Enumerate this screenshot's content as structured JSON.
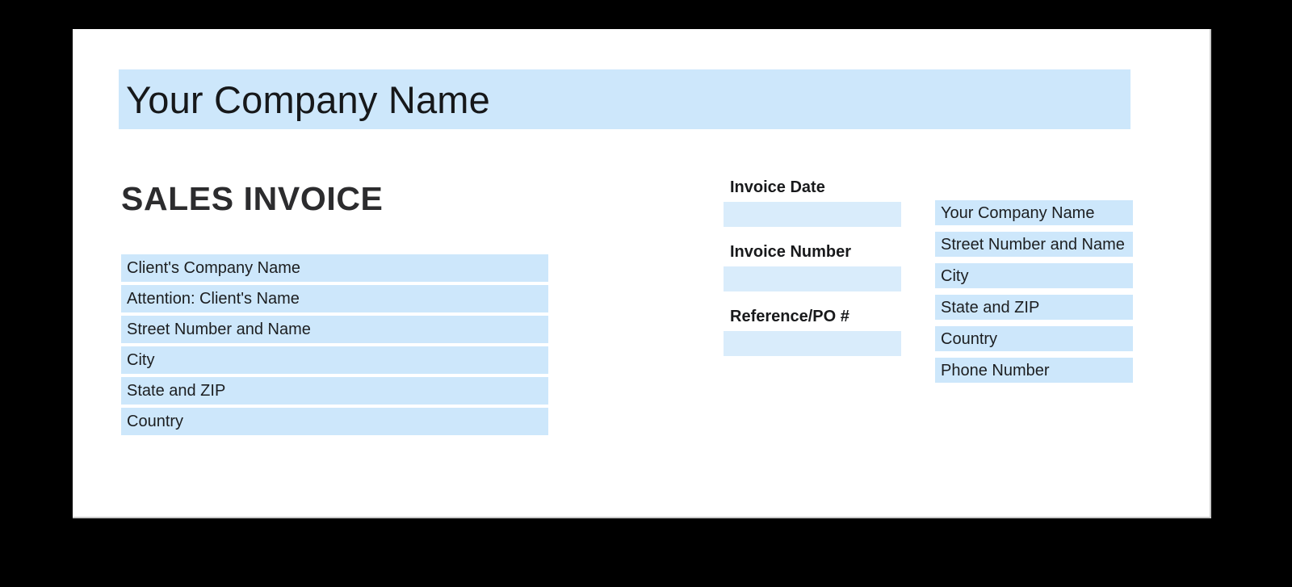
{
  "document": {
    "header_banner": {
      "company_name": "Your Company Name"
    },
    "title": "SALES INVOICE",
    "client_address_block": {
      "rows": [
        {
          "label": "Client's Company Name"
        },
        {
          "label": "Attention: Client's Name"
        },
        {
          "label": "Street Number and Name"
        },
        {
          "label": "City"
        },
        {
          "label": "State and ZIP"
        },
        {
          "label": "Country"
        }
      ]
    },
    "invoice_meta": {
      "fields": [
        {
          "label": "Invoice Date",
          "value": ""
        },
        {
          "label": "Invoice Number",
          "value": ""
        },
        {
          "label": "Reference/PO #",
          "value": ""
        }
      ]
    },
    "company_address_block": {
      "rows": [
        {
          "label": "Your Company Name"
        },
        {
          "label": "Street Number and Name"
        },
        {
          "label": "City"
        },
        {
          "label": "State and ZIP"
        },
        {
          "label": "Country"
        },
        {
          "label": "Phone Number"
        }
      ]
    }
  },
  "colors": {
    "field_fill": "#cde7fb",
    "input_fill": "#d9ecfb",
    "page_background": "#ffffff",
    "canvas_background": "#000000",
    "text": "#1c1e20",
    "heading_text": "#2c2c2e"
  }
}
